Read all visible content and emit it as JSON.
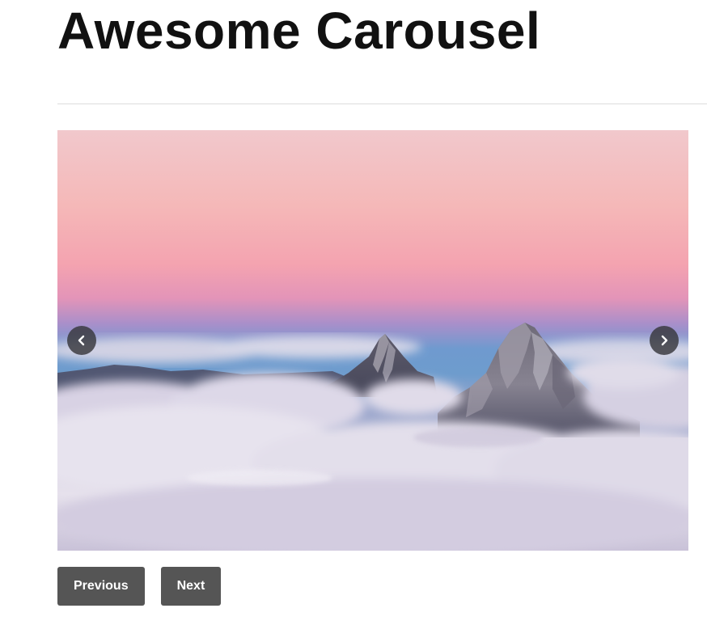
{
  "page": {
    "title": "Awesome Carousel"
  },
  "carousel": {
    "slide": {
      "scene": "pink-sunset-mountain-peaks-above-clouds"
    },
    "prev_arrow_icon": "chevron-left-icon",
    "next_arrow_icon": "chevron-right-icon"
  },
  "controls": {
    "previous_label": "Previous",
    "next_label": "Next"
  },
  "colors": {
    "button_bg": "#555555",
    "button_text": "#ffffff",
    "arrow_bg": "#37373c",
    "title_text": "#111111"
  }
}
